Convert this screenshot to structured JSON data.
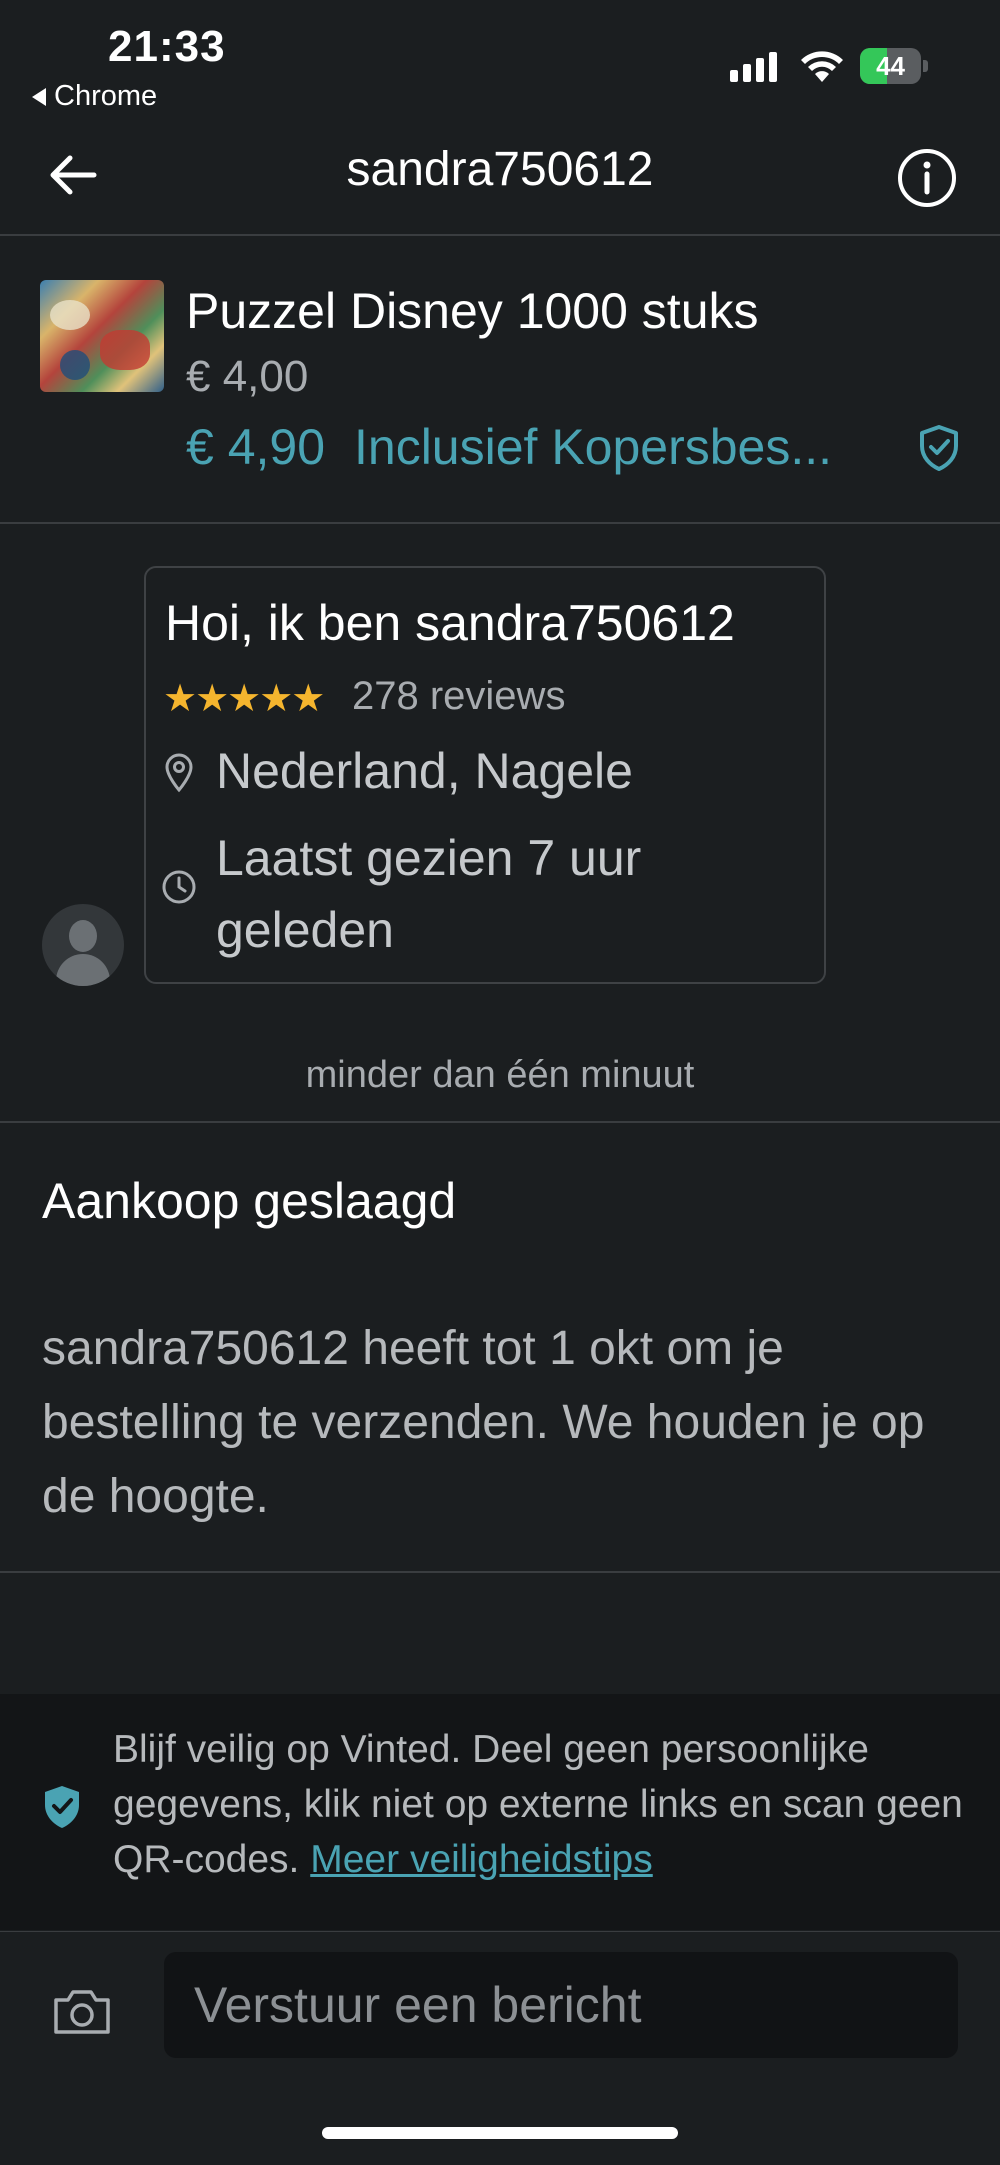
{
  "status_bar": {
    "time": "21:33",
    "back_app": "Chrome",
    "battery": "44",
    "battery_level": 0.44
  },
  "nav": {
    "title": "sandra750612",
    "back_icon": "arrow-left-icon",
    "info_icon": "info-icon"
  },
  "item": {
    "title": "Puzzel Disney 1000 stuks",
    "price": "€ 4,00",
    "total_price": "€ 4,90",
    "total_label": "Inclusief Kopersbes...",
    "shield_icon": "shield-check-icon"
  },
  "profile": {
    "greeting": "Hoi, ik ben sandra750612",
    "stars": "★★★★★",
    "rating": 5,
    "reviews": "278 reviews",
    "location": "Nederland, Nagele",
    "last_seen": "Laatst gezien 7 uur geleden"
  },
  "message": {
    "timestamp": "minder dan één minuut"
  },
  "status": {
    "title": "Aankoop geslaagd",
    "body": "sandra750612 heeft tot 1 okt om je bestelling te verzenden. We houden je op de hoogte."
  },
  "safety": {
    "text": "Blijf veilig op Vinted. Deel geen persoonlijke gegevens, klik niet op externe links en scan geen QR-codes.",
    "link": "Meer veiligheidstips"
  },
  "composer": {
    "placeholder": "Verstuur een bericht",
    "camera_icon": "camera-icon"
  },
  "colors": {
    "accent": "#4aa3b3",
    "background": "#1b1e20",
    "star": "#f5b52e",
    "battery": "#34c759"
  }
}
